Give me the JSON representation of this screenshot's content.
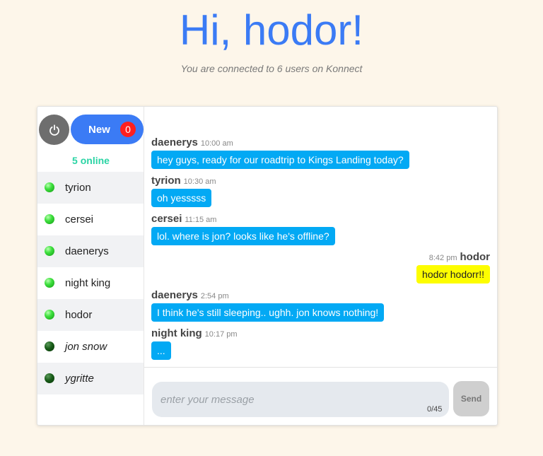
{
  "header": {
    "title": "Hi, hodor!",
    "subtitle": "You are connected to 6 users on Konnect"
  },
  "sidebar": {
    "power_icon": "power-icon",
    "new_label": "New",
    "new_count": "0",
    "online_label": "5 online",
    "users": [
      {
        "name": "tyrion",
        "online": true
      },
      {
        "name": "cersei",
        "online": true
      },
      {
        "name": "daenerys",
        "online": true
      },
      {
        "name": "night king",
        "online": true
      },
      {
        "name": "hodor",
        "online": true
      },
      {
        "name": "jon snow",
        "online": false
      },
      {
        "name": "ygritte",
        "online": false
      }
    ]
  },
  "messages": [
    {
      "author": "daenerys",
      "time": "10:00 am",
      "text": "hey guys, ready for our roadtrip to Kings Landing today?",
      "mine": false
    },
    {
      "author": "tyrion",
      "time": "10:30 am",
      "text": "oh yesssss",
      "mine": false
    },
    {
      "author": "cersei",
      "time": "11:15 am",
      "text": "lol. where is jon? looks like he's offline?",
      "mine": false
    },
    {
      "author": "hodor",
      "time": "8:42 pm",
      "text": "hodor hodorr!!",
      "mine": true
    },
    {
      "author": "daenerys",
      "time": "2:54 pm",
      "text": "I think he's still sleeping.. ughh. jon knows nothing!",
      "mine": false
    },
    {
      "author": "night king",
      "time": "10:17 pm",
      "text": "...",
      "mine": false
    }
  ],
  "composer": {
    "placeholder": "enter your message",
    "value": "",
    "char_count": "0/45",
    "send_label": "Send"
  },
  "colors": {
    "accent": "#3b7bf5",
    "online": "#2ad4a4",
    "bubble": "#03a9f4",
    "own_bubble": "#fdfd00",
    "badge": "#ff1f1f"
  }
}
